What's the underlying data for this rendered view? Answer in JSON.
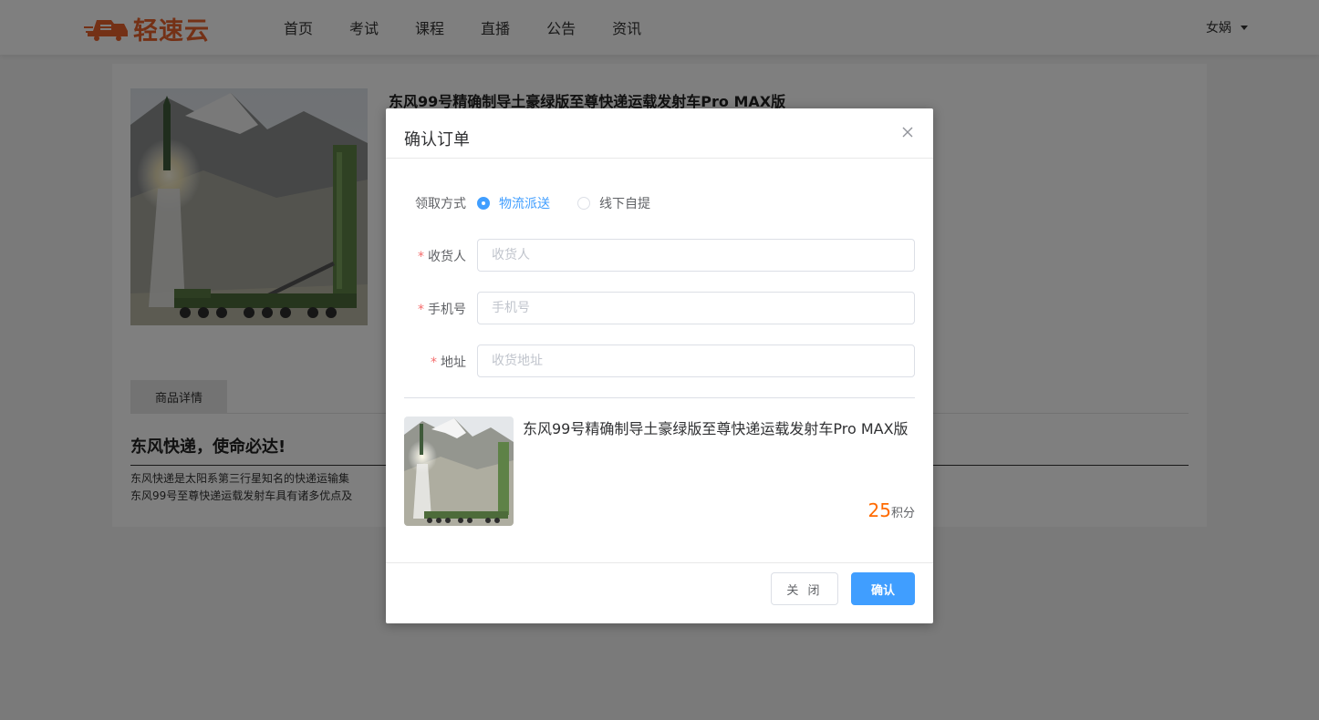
{
  "header": {
    "logo_text": "轻速云",
    "nav": [
      "首页",
      "考试",
      "课程",
      "直播",
      "公告",
      "资讯"
    ],
    "user_name": "女娲"
  },
  "product": {
    "title": "东风99号精确制导土豪绿版至尊快递运载发射车Pro MAX版",
    "tab_label": "商品详情",
    "detail_heading": "东风快递，使命必达!",
    "detail_lines": [
      "东风快递是太阳系第三行星知名的快递运输集",
      "东风99号至尊快递运载发射车具有诸多优点及"
    ]
  },
  "dialog": {
    "title": "确认订单",
    "delivery_label": "领取方式",
    "delivery_options": [
      "物流派送",
      "线下自提"
    ],
    "delivery_selected": "物流派送",
    "fields": [
      {
        "label": "收货人",
        "placeholder": "收货人",
        "value": ""
      },
      {
        "label": "手机号",
        "placeholder": "手机号",
        "value": ""
      },
      {
        "label": "地址",
        "placeholder": "收货地址",
        "value": ""
      }
    ],
    "item_name": "东风99号精确制导土豪绿版至尊快递运载发射车Pro MAX版",
    "price_value": "25",
    "price_unit": "积分",
    "cancel_label": "关 闭",
    "confirm_label": "确认"
  },
  "colors": {
    "brand": "#e8622c",
    "primary": "#409eff",
    "price": "#ff6a00",
    "required": "#f56c6c"
  }
}
